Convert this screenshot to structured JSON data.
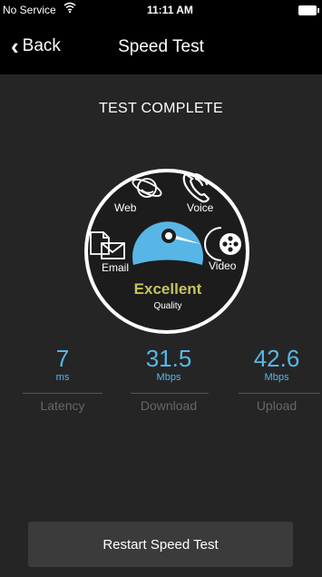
{
  "status": {
    "carrier": "No Service",
    "time": "11:11 AM"
  },
  "nav": {
    "back_label": "Back",
    "title": "Speed Test"
  },
  "result": {
    "headline": "TEST COMPLETE"
  },
  "dial": {
    "web": "Web",
    "voice": "Voice",
    "email": "Email",
    "video": "Video",
    "rating": "Excellent",
    "rating_sub": "Quality"
  },
  "metrics": {
    "latency": {
      "value": "7",
      "unit": "ms",
      "label": "Latency"
    },
    "download": {
      "value": "31.5",
      "unit": "Mbps",
      "label": "Download"
    },
    "upload": {
      "value": "42.6",
      "unit": "Mbps",
      "label": "Upload"
    }
  },
  "actions": {
    "restart_label": "Restart Speed Test"
  },
  "colors": {
    "accent": "#58b6e6",
    "rating": "#c6c25f",
    "background": "#252526"
  }
}
